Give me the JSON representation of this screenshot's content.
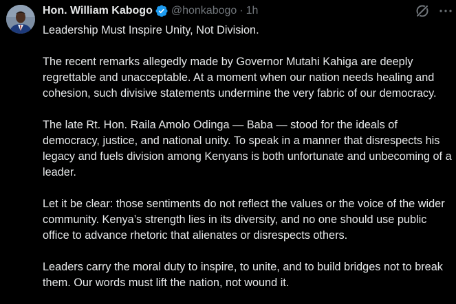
{
  "author": {
    "display_name": "Hon. William Kabogo",
    "handle": "@honkabogo",
    "separator": "·",
    "time": "1h",
    "verified": true
  },
  "icons": {
    "avatar": "avatar-photo",
    "verified": "verified-badge-icon",
    "grok": "grok-icon",
    "more": "more-icon"
  },
  "colors": {
    "background": "#000000",
    "text": "#e7e9ea",
    "secondary_text": "#71767b",
    "verified_blue": "#1d9bf0"
  },
  "tweet": {
    "paragraphs": [
      "Leadership Must Inspire Unity, Not Division.",
      "The recent remarks allegedly made by Governor Mutahi Kahiga are deeply regrettable and unacceptable. At a moment when our nation needs healing and cohesion, such divisive statements undermine the very fabric of our democracy.",
      "The late Rt. Hon. Raila Amolo Odinga — Baba — stood for the ideals of democracy, justice, and national unity. To speak in a manner that disrespects his legacy and fuels division among Kenyans is both unfortunate and unbecoming of a leader.",
      "Let it be clear: those sentiments do not reflect the values or the voice of the wider community. Kenya’s strength lies in its diversity, and no one should use public office to advance rhetoric that alienates or disrespects others.",
      "Leaders carry the moral duty to inspire, to unite, and to build bridges not to break them. Our words must lift the nation, not wound it."
    ]
  }
}
